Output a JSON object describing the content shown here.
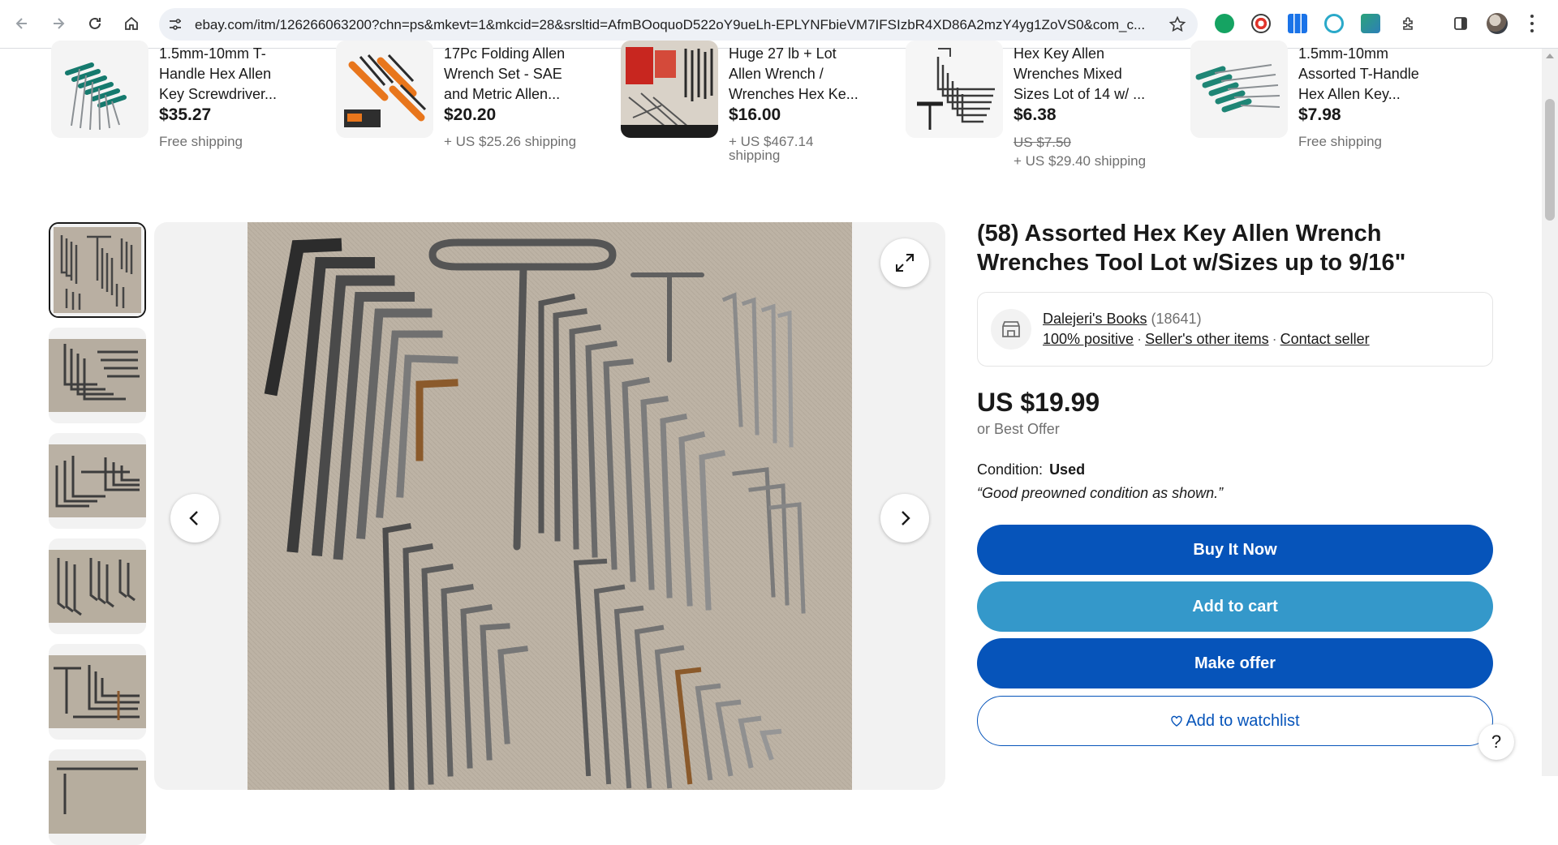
{
  "browser": {
    "url": "ebay.com/itm/126266063200?chn=ps&mkevt=1&mkcid=28&srsltid=AfmBOoquoD522oY9ueLh-EPLYNFbieVM7IFSIzbR4XD86A2mzY4yg1ZoVS0&com_c..."
  },
  "similar_items": [
    {
      "title": "1.5mm-10mm T-Handle Hex Allen Key Screwdriver...",
      "price": "$35.27",
      "original_price": "",
      "shipping": "Free shipping"
    },
    {
      "title": "17Pc Folding Allen Wrench Set - SAE and Metric Allen...",
      "price": "$20.20",
      "original_price": "",
      "shipping": "+ US $25.26 shipping"
    },
    {
      "title": "Huge 27 lb + Lot Allen Wrench / Wrenches Hex Ke...",
      "price": "$16.00",
      "original_price": "",
      "shipping": "+ US $467.14 shipping"
    },
    {
      "title": "Hex Key Allen Wrenches Mixed Sizes Lot of 14 w/ ...",
      "price": "$6.38",
      "original_price": "US $7.50",
      "shipping": "+ US $29.40 shipping"
    },
    {
      "title": "1.5mm-10mm Assorted T-Handle Hex Allen Key...",
      "price": "$7.98",
      "original_price": "",
      "shipping": "Free shipping"
    }
  ],
  "listing": {
    "title": "(58) Assorted Hex Key Allen Wrench Wrenches Tool Lot w/Sizes up to 9/16\"",
    "seller": {
      "name": "Dalejeri's Books",
      "feedback_count": "(18641)",
      "positive": "100% positive",
      "other_items": "Seller's other items",
      "contact": "Contact seller"
    },
    "price": "US $19.99",
    "best_offer": "or Best Offer",
    "condition_label": "Condition:",
    "condition_value": "Used",
    "condition_note": "“Good preowned condition as shown.”",
    "buttons": {
      "buy_now": "Buy It Now",
      "add_to_cart": "Add to cart",
      "make_offer": "Make offer",
      "watchlist": "Add to watchlist"
    }
  },
  "help": "?",
  "colors": {
    "primary_blue": "#0654ba",
    "secondary_blue": "#3498ca",
    "text": "#191919",
    "muted": "#707070"
  }
}
